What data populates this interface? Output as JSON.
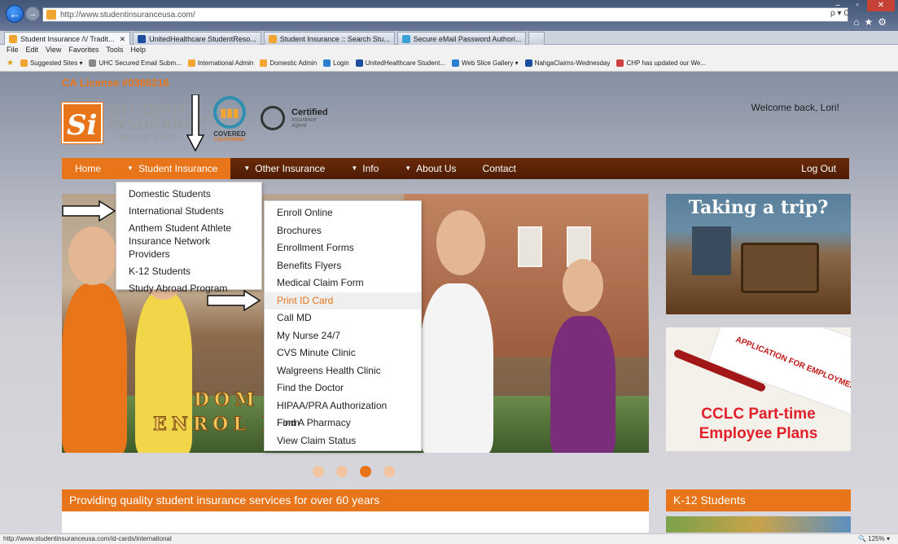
{
  "browser": {
    "url": "http://www.studentinsuranceusa.com/",
    "search_label": "ρ ▾ C",
    "tabs": [
      {
        "label": "Student Insurance /\\/ Tradit...",
        "color": "#f2a531"
      },
      {
        "label": "UnitedHealthcare StudentReso...",
        "color": "#1a4fa0"
      },
      {
        "label": "Student Insurance :: Search Stu...",
        "color": "#f2a531"
      },
      {
        "label": "Secure eMail Password Authori...",
        "color": "#3aa0d8"
      }
    ],
    "tab_close": "✕",
    "menu": [
      "File",
      "Edit",
      "View",
      "Favorites",
      "Tools",
      "Help"
    ],
    "favorites": [
      {
        "label": "Suggested Sites ▾",
        "color": "#f2a531"
      },
      {
        "label": "UHC Secured Email Subm...",
        "color": "#888"
      },
      {
        "label": "International Admin",
        "color": "#f2a531"
      },
      {
        "label": "Domestic Admin",
        "color": "#f2a531"
      },
      {
        "label": "Login",
        "color": "#2a7fd0"
      },
      {
        "label": "UnitedHealthcare Student...",
        "color": "#1a4fa0"
      },
      {
        "label": "Web Slice Gallery ▾",
        "color": "#2a7fd0"
      },
      {
        "label": "NahgaClaims-Wednesday",
        "color": "#1a4fa0"
      },
      {
        "label": "CHP has updated our We...",
        "color": "#d04040"
      }
    ],
    "status_url": "http://www.studentinsuranceusa.com/id-cards/international",
    "zoom": "125%"
  },
  "page": {
    "license": "CA License #0386216",
    "logo": {
      "mark": "Si",
      "word1": "STUDENT",
      "word2": "INSURANCE",
      "since": "SINCE 1950"
    },
    "covered": {
      "title": "COVERED",
      "subtitle": "CALIFORNIA"
    },
    "certified": {
      "title": "Certified",
      "line1": "Insurance",
      "line2": "Agent"
    },
    "welcome": "Welcome back, Lori!",
    "nav": {
      "home": "Home",
      "student_insurance": "Student Insurance",
      "other_insurance": "Other Insurance",
      "info": "Info",
      "about_us": "About Us",
      "contact": "Contact",
      "log_out": "Log Out"
    },
    "student_menu": [
      "Domestic Students",
      "International Students",
      "Anthem Student Athlete",
      "Insurance Network Providers",
      "K-12 Students",
      "Study Abroad Program"
    ],
    "intl_menu": [
      "Enroll Online",
      "Brochures",
      "Enrollment Forms",
      "Benefits Flyers",
      "Medical Claim Form",
      "Print ID Card",
      "Call MD",
      "My Nurse 24/7",
      "CVS Minute Clinic",
      "Walgreens Health Clinic",
      "Find the Doctor",
      "HIPAA/PRA Authorization Form",
      "Find A Pharmacy",
      "View Claim Status"
    ],
    "hero": {
      "line1": "DOM          UDENT",
      "line2": "ENROL          PEN NOW!"
    },
    "side1": {
      "title": "Taking a trip?"
    },
    "side2": {
      "app": "APPLICATION FOR EMPLOYMENT",
      "line1": "CCLC Part-time",
      "line2": "Employee Plans"
    },
    "carousel_active": 3,
    "footer_main": "Providing quality student insurance services for over 60 years",
    "footer_side": "K-12 Students"
  },
  "colors": {
    "accent": "#e8751a",
    "nav": "#4e1c04",
    "highlight": "#e8751a"
  }
}
